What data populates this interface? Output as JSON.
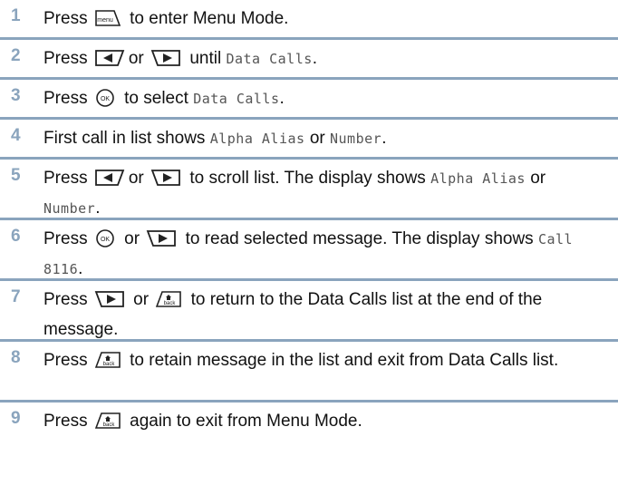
{
  "steps": [
    {
      "num": "1",
      "parts": [
        {
          "t": "text",
          "v": "Press "
        },
        {
          "t": "icon",
          "v": "menu-key-icon"
        },
        {
          "t": "text",
          "v": " to enter Menu Mode."
        }
      ]
    },
    {
      "num": "2",
      "parts": [
        {
          "t": "text",
          "v": "Press "
        },
        {
          "t": "icon",
          "v": "left-softkey-icon"
        },
        {
          "t": "text",
          "v": "or "
        },
        {
          "t": "icon",
          "v": "right-softkey-icon"
        },
        {
          "t": "text",
          "v": " until "
        },
        {
          "t": "mono",
          "v": "Data Calls"
        },
        {
          "t": "text",
          "v": "."
        }
      ]
    },
    {
      "num": "3",
      "parts": [
        {
          "t": "text",
          "v": "Press "
        },
        {
          "t": "icon",
          "v": "ok-key-icon"
        },
        {
          "t": "text",
          "v": " to select "
        },
        {
          "t": "mono",
          "v": "Data Calls"
        },
        {
          "t": "text",
          "v": "."
        }
      ]
    },
    {
      "num": "4",
      "parts": [
        {
          "t": "text",
          "v": "First call in list shows "
        },
        {
          "t": "mono",
          "v": "Alpha Alias"
        },
        {
          "t": "text",
          "v": " or "
        },
        {
          "t": "mono",
          "v": "Number"
        },
        {
          "t": "text",
          "v": "."
        }
      ]
    },
    {
      "num": "5",
      "parts": [
        {
          "t": "text",
          "v": "Press "
        },
        {
          "t": "icon",
          "v": "left-softkey-icon"
        },
        {
          "t": "text",
          "v": "or "
        },
        {
          "t": "icon",
          "v": "right-softkey-icon"
        },
        {
          "t": "text",
          "v": " to scroll list. The display shows "
        },
        {
          "t": "mono",
          "v": "Alpha Alias"
        },
        {
          "t": "text",
          "v": " or "
        },
        {
          "t": "mono",
          "v": "Number"
        },
        {
          "t": "text",
          "v": "."
        }
      ]
    },
    {
      "num": "6",
      "parts": [
        {
          "t": "text",
          "v": "Press "
        },
        {
          "t": "icon",
          "v": "ok-key-icon"
        },
        {
          "t": "text",
          "v": " or "
        },
        {
          "t": "icon",
          "v": "right-softkey-icon"
        },
        {
          "t": "text",
          "v": " to read selected message. The display shows "
        },
        {
          "t": "mono",
          "v": "Call 8116"
        },
        {
          "t": "text",
          "v": "."
        }
      ]
    },
    {
      "num": "7",
      "parts": [
        {
          "t": "text",
          "v": "Press "
        },
        {
          "t": "icon",
          "v": "right-softkey-icon"
        },
        {
          "t": "text",
          "v": " or "
        },
        {
          "t": "icon",
          "v": "back-key-icon"
        },
        {
          "t": "text",
          "v": " to return to the Data Calls list at the end of the message."
        }
      ]
    },
    {
      "num": "8",
      "parts": [
        {
          "t": "text",
          "v": "Press "
        },
        {
          "t": "icon",
          "v": "back-key-icon"
        },
        {
          "t": "text",
          "v": " to retain message in the list and exit from Data Calls list."
        }
      ]
    },
    {
      "num": "9",
      "parts": [
        {
          "t": "text",
          "v": "Press "
        },
        {
          "t": "icon",
          "v": "back-key-icon"
        },
        {
          "t": "text",
          "v": " again to exit from Menu Mode."
        }
      ]
    }
  ],
  "icon_labels": {
    "menu": "menu",
    "back": "back"
  }
}
